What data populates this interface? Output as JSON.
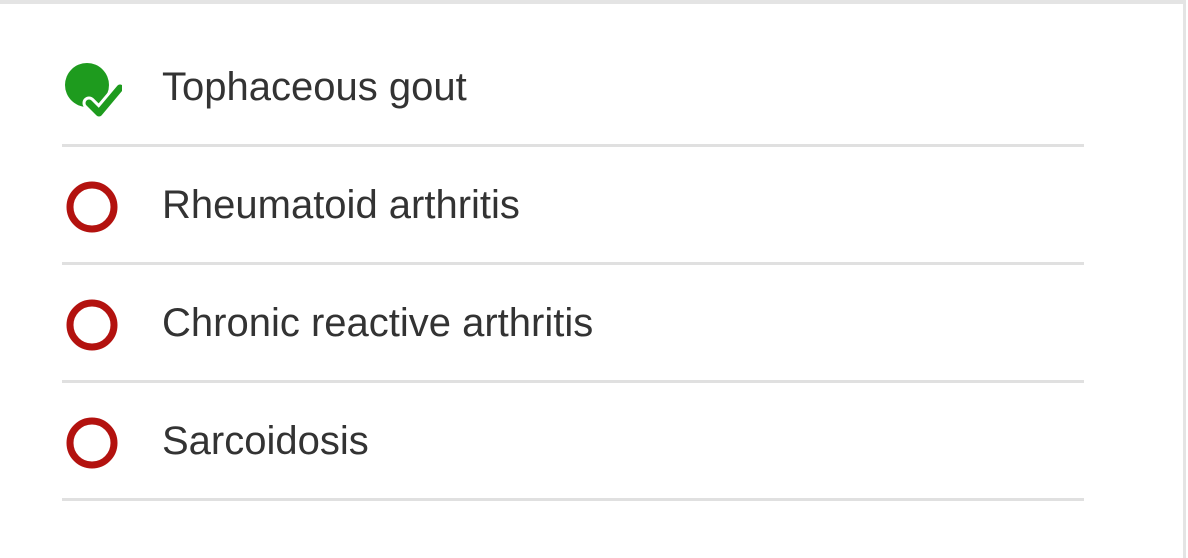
{
  "question": {
    "options": [
      {
        "label": "Tophaceous gout",
        "status": "correct",
        "icon": "correct-check-icon"
      },
      {
        "label": "Rheumatoid arthritis",
        "status": "incorrect",
        "icon": "incorrect-circle-icon"
      },
      {
        "label": "Chronic reactive arthritis",
        "status": "incorrect",
        "icon": "incorrect-circle-icon"
      },
      {
        "label": "Sarcoidosis",
        "status": "incorrect",
        "icon": "incorrect-circle-icon"
      }
    ]
  },
  "colors": {
    "correct": "#1e9b1e",
    "incorrect": "#b3120f",
    "text": "#333333",
    "divider": "#e0e0e0"
  }
}
